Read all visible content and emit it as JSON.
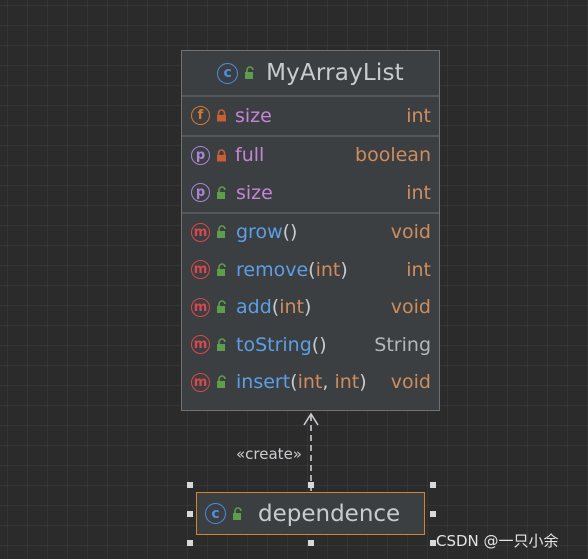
{
  "class": {
    "badge": "c",
    "name": "MyArrayList",
    "fields": [
      {
        "badge": "f",
        "access": "private",
        "name": "size",
        "type": "int"
      }
    ],
    "properties": [
      {
        "badge": "p",
        "access": "private",
        "name": "full",
        "type": "boolean"
      },
      {
        "badge": "p",
        "access": "public",
        "name": "size",
        "type": "int"
      }
    ],
    "methods": [
      {
        "badge": "m",
        "access": "public",
        "name": "grow",
        "open": "(",
        "params": [],
        "close": ")",
        "type": "void"
      },
      {
        "badge": "m",
        "access": "public",
        "name": "remove",
        "open": "(",
        "p1": "int",
        "close": ")",
        "type": "int"
      },
      {
        "badge": "m",
        "access": "public",
        "name": "add",
        "open": "(",
        "p1": "int",
        "close": ")",
        "type": "void"
      },
      {
        "badge": "m",
        "access": "public",
        "name": "toString",
        "open": "(",
        "close": ")",
        "type": "String"
      },
      {
        "badge": "m",
        "access": "public",
        "name": "insert",
        "open": "(",
        "p1": "int",
        "sep": ", ",
        "p2": "int",
        "close": ")",
        "type": "void"
      }
    ]
  },
  "relation": {
    "label": "«create»",
    "style": "dashed",
    "arrow": "open"
  },
  "dependent_class": {
    "badge": "c",
    "access": "public",
    "name": "dependence"
  },
  "watermark": "CSDN @一只小余",
  "colors": {
    "background": "#2b2b2b",
    "box": "#3c3f41",
    "selection_border": "#d0862c",
    "field_name": "#c585d6",
    "method_name": "#5c9fe6",
    "type": "#cf8d5e",
    "lock_private": "#c75e34",
    "lock_public": "#5e9e4b"
  }
}
